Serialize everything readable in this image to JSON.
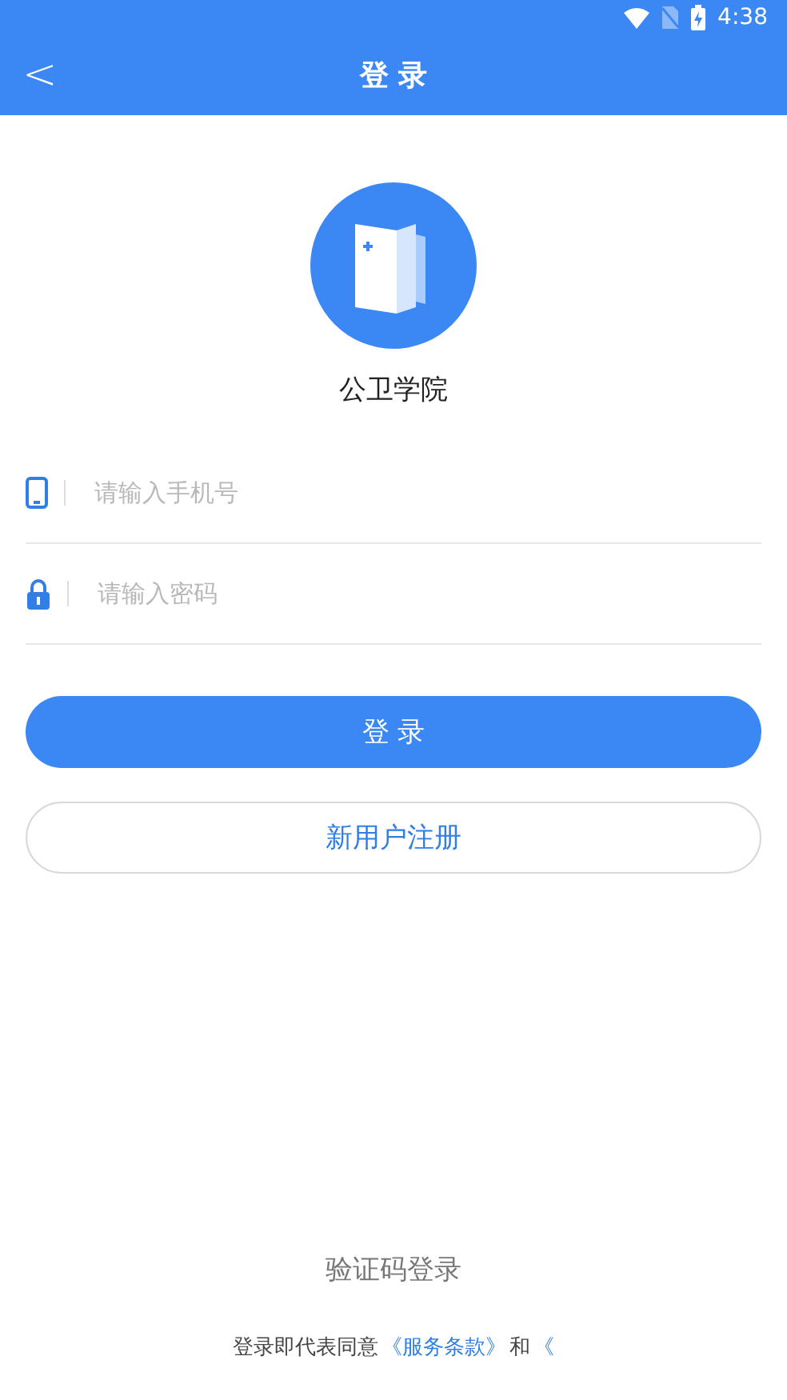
{
  "status_bar": {
    "time": "4:38"
  },
  "app_bar": {
    "title": "登 录",
    "back": "<"
  },
  "app": {
    "name": "公卫学院"
  },
  "fields": [
    {
      "kind": "phone",
      "placeholder": "请输入手机号"
    },
    {
      "kind": "password",
      "placeholder": "请输入密码"
    }
  ],
  "login_button": "登 录",
  "register_button": "新用户注册",
  "sms_login": "验证码登录",
  "agreement": {
    "text": "登录即代表同意",
    "terms_link": "《服务条款》",
    "and": "和",
    "privacy_link": "《"
  }
}
